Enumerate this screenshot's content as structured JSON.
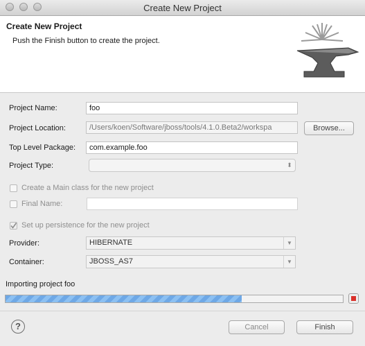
{
  "window": {
    "title": "Create New Project"
  },
  "banner": {
    "title": "Create New Project",
    "description": "Push the Finish button to create the project."
  },
  "form": {
    "project_name": {
      "label": "Project Name:",
      "value": "foo"
    },
    "project_location": {
      "label": "Project Location:",
      "value": "/Users/koen/Software/jboss/tools/4.1.0.Beta2/workspa",
      "browse_label": "Browse..."
    },
    "top_level_package": {
      "label": "Top Level Package:",
      "value": "com.example.foo"
    },
    "project_type": {
      "label": "Project Type:",
      "value": ""
    },
    "main_class": {
      "label": "Create a Main class for the new project",
      "checked": false,
      "enabled": false
    },
    "final_name": {
      "label": "Final Name:",
      "value": "",
      "enabled": false
    },
    "persistence": {
      "label": "Set up persistence for the new project",
      "checked": true,
      "enabled": false
    },
    "provider": {
      "label": "Provider:",
      "value": "HIBERNATE"
    },
    "container": {
      "label": "Container:",
      "value": "JBOSS_AS7"
    }
  },
  "progress": {
    "label": "Importing project foo",
    "fraction": 0.7
  },
  "footer": {
    "cancel_label": "Cancel",
    "finish_label": "Finish",
    "help_label": "?"
  },
  "icons": {
    "close": "window-close-icon",
    "minimize": "window-minimize-icon",
    "zoom": "window-zoom-icon",
    "banner": "anvil-icon",
    "stop": "stop-icon",
    "help": "help-icon"
  }
}
